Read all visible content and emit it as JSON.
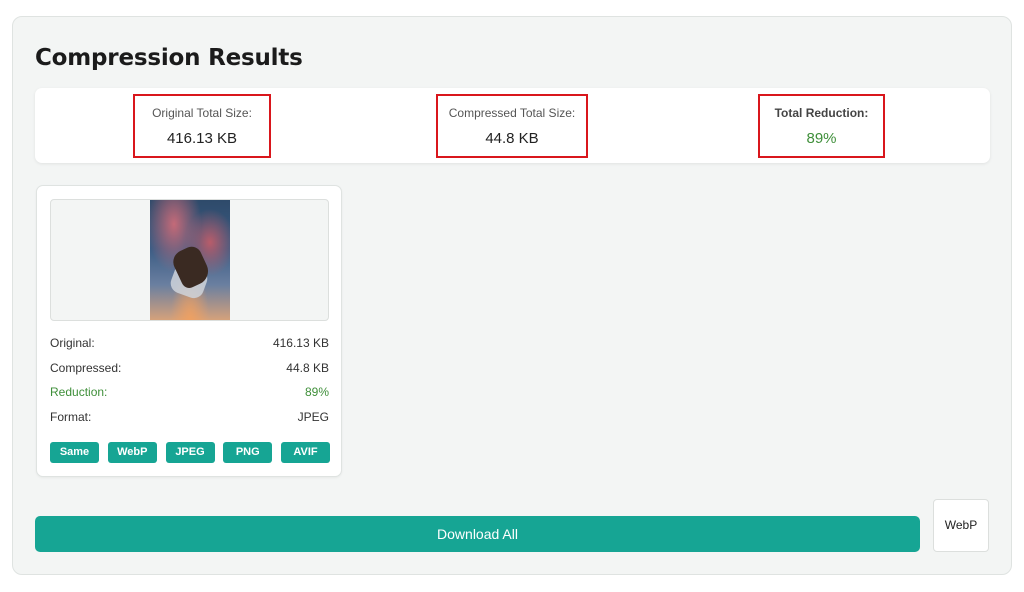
{
  "page": {
    "title": "Compression Results"
  },
  "summary": {
    "original": {
      "label": "Original Total Size:",
      "value": "416.13 KB"
    },
    "compressed": {
      "label": "Compressed Total Size:",
      "value": "44.8 KB"
    },
    "reduction": {
      "label": "Total Reduction:",
      "value": "89%"
    }
  },
  "file_card": {
    "preview_alt": "skydiver image preview",
    "rows": [
      {
        "label": "Original:",
        "value": "416.13 KB"
      },
      {
        "label": "Compressed:",
        "value": "44.8 KB"
      },
      {
        "label": "Reduction:",
        "value": "89%"
      },
      {
        "label": "Format:",
        "value": "JPEG"
      }
    ],
    "format_buttons": [
      "Same",
      "WebP",
      "JPEG",
      "PNG",
      "AVIF"
    ]
  },
  "actions": {
    "download_all": "Download All",
    "format_select_value": "WebP"
  },
  "colors": {
    "accent": "#16a594",
    "success": "#3f8f3a",
    "highlight_border": "#d9161c"
  }
}
